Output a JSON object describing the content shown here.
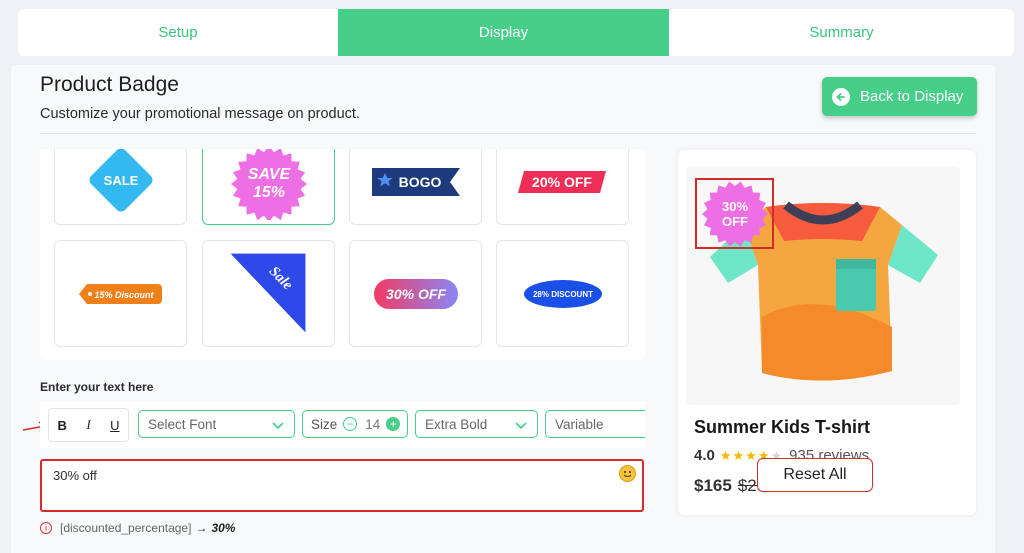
{
  "tabs": [
    {
      "label": "Setup"
    },
    {
      "label": "Display"
    },
    {
      "label": "Summary"
    }
  ],
  "header": {
    "title": "Product Badge",
    "subtitle": "Customize your promotional message on product.",
    "back_label": "Back to Display"
  },
  "badges": [
    {
      "text": "SALE"
    },
    {
      "line1": "SAVE",
      "line2": "15%"
    },
    {
      "text": "BOGO"
    },
    {
      "text": "20% OFF"
    },
    {
      "text": "15% Discount"
    },
    {
      "text": "Sale"
    },
    {
      "text": "30% OFF"
    },
    {
      "text": "28% DISCOUNT"
    }
  ],
  "editor": {
    "label": "Enter your text here",
    "bold": "B",
    "italic": "I",
    "underline": "U",
    "font_placeholder": "Select Font",
    "size_label": "Size",
    "size_value": "14",
    "weight": "Extra Bold",
    "variable": "Variable",
    "text_value": "30% off",
    "hint_token": "[discounted_percentage]",
    "hint_arrow": "→",
    "hint_value": "30%"
  },
  "preview": {
    "badge_line1": "30%",
    "badge_line2": "OFF",
    "product_name": "Summer Kids T-shirt",
    "rating": "4.0",
    "stars_filled": 4,
    "stars_total": 5,
    "reviews": "935 reviews",
    "price": "$165",
    "old_price": "$285"
  },
  "reset_label": "Reset All",
  "colors": {
    "accent": "#45cf88",
    "highlight": "#d42a2a"
  }
}
